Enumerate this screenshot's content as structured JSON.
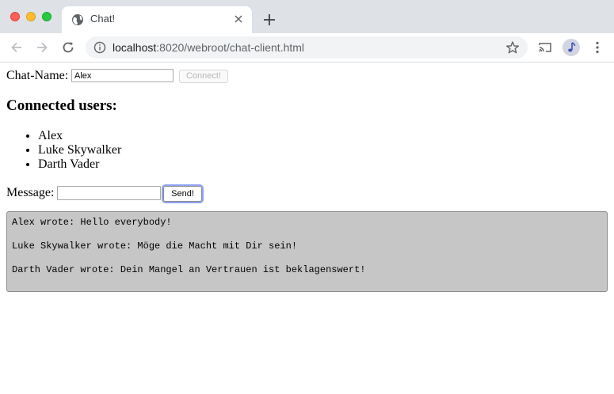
{
  "browser": {
    "tab_title": "Chat!",
    "url_host": "localhost",
    "url_rest": ":8020/webroot/chat-client.html"
  },
  "page": {
    "name_label": "Chat-Name:",
    "name_value": "Alex",
    "connect_label": "Connect!",
    "users_heading": "Connected users:",
    "users": [
      "Alex",
      "Luke Skywalker",
      "Darth Vader"
    ],
    "message_label": "Message:",
    "message_value": "",
    "send_label": "Send!",
    "messages": [
      "Alex wrote: Hello everybody!",
      "Luke Skywalker wrote: Möge die Macht mit Dir sein!",
      "Darth Vader wrote: Dein Mangel an Vertrauen ist beklagenswert!"
    ]
  },
  "colors": {
    "tabbar_bg": "#dee1e6",
    "chat_log_bg": "#c6c6c6",
    "send_focus_ring": "#8ea3f4"
  }
}
